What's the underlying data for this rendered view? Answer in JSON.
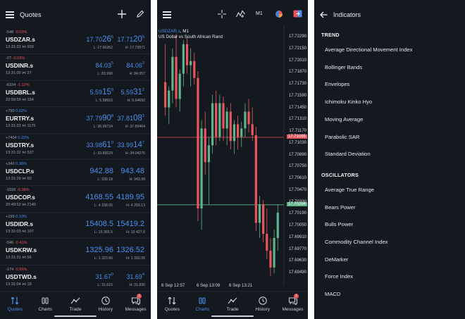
{
  "quotes": {
    "title": "Quotes",
    "items": [
      {
        "delta": "-548",
        "pct": "-0.03%",
        "pct_color": "neg",
        "symbol": "USDZAR.s",
        "time": "13:31:32",
        "vol": "939",
        "bid_a": "17.70",
        "bid_b": "26",
        "bid_s": "6",
        "ask_a": "17.71",
        "ask_b": "20",
        "ask_s": "5",
        "low": "L: 17.66262",
        "high": "H: 17.73571"
      },
      {
        "delta": "-27",
        "pct": "-0.03%",
        "pct_color": "neg",
        "symbol": "USDINR.s",
        "time": "13:31:00",
        "vol": "27",
        "bid_a": "84.03",
        "bid_b": "",
        "bid_s": "5",
        "ask_a": "84.06",
        "ask_b": "",
        "ask_s": "2",
        "low": "L: 83.990",
        "high": "H: 84.057"
      },
      {
        "delta": "-6334",
        "pct": "-1.12%",
        "pct_color": "neg",
        "symbol": "USDBRL.s",
        "time": "22:59:59",
        "vol": "154",
        "bid_a": "5.59",
        "bid_b": "15",
        "bid_s": "8",
        "ask_a": "5.59",
        "ask_b": "31",
        "ask_s": "2",
        "low": "L: 5.58915",
        "high": "H: 5.64692"
      },
      {
        "delta": "+790",
        "pct": "0.02%",
        "pct_color": "pos",
        "symbol": "EURTRY.s",
        "time": "13:31:32",
        "vol": "1175",
        "bid_a": "37.79",
        "bid_b": "90",
        "bid_s": "8",
        "ask_a": "37.81",
        "ask_b": "08",
        "ask_s": "3",
        "low": "L: 36.99724",
        "high": "H: 37.89464"
      },
      {
        "delta": "+7404",
        "pct": "0.22%",
        "pct_color": "pos",
        "symbol": "USDTRY.s",
        "time": "13:31:32",
        "vol": "537",
        "bid_a": "33.98",
        "bid_b": "61",
        "bid_s": "0",
        "ask_a": "33.99",
        "ask_b": "14",
        "ask_s": "7",
        "low": "L: 33.89529",
        "high": "H: 34.04276"
      },
      {
        "delta": "+340",
        "pct": "0.36%",
        "pct_color": "pos",
        "symbol": "USDCLP.s",
        "time": "13:31:29",
        "vol": "60",
        "bid_a": "942.88",
        "bid_b": "",
        "bid_s": "",
        "ask_a": "943.48",
        "ask_b": "",
        "ask_s": "",
        "low": "L: 939.18",
        "high": "H: 943.99"
      },
      {
        "delta": "-1599",
        "pct": "-0.38%",
        "pct_color": "neg",
        "symbol": "USDCOP.s",
        "time": "20:49:52",
        "vol": "2140",
        "bid_a": "4168.55",
        "bid_b": "",
        "bid_s": "",
        "ask_a": "4189.95",
        "ask_b": "",
        "ask_s": "",
        "low": "L: 4 168.05",
        "high": "H: 4 203.13"
      },
      {
        "delta": "+159",
        "pct": "0.10%",
        "pct_color": "pos",
        "symbol": "USDIDR.s",
        "time": "13:31:03",
        "vol": "107",
        "bid_a": "15408.5",
        "bid_b": "",
        "bid_s": "",
        "ask_a": "15419.2",
        "ask_b": "",
        "ask_s": "",
        "low": "L: 15 365.5",
        "high": "H: 15 427.6"
      },
      {
        "delta": "-546",
        "pct": "-0.41%",
        "pct_color": "neg",
        "symbol": "USDKRW.s",
        "time": "13:31:31",
        "vol": "56",
        "bid_a": "1325.96",
        "bid_b": "",
        "bid_s": "",
        "ask_a": "1326.52",
        "ask_b": "",
        "ask_s": "",
        "low": "L: 1 323.66",
        "high": "H: 1 332.05"
      },
      {
        "delta": "-174",
        "pct": "-0.55%",
        "pct_color": "neg",
        "symbol": "USDTWD.s",
        "time": "13:31:04",
        "vol": "18",
        "bid_a": "31.67",
        "bid_b": "",
        "bid_s": "0",
        "ask_a": "31.69",
        "ask_b": "",
        "ask_s": "4",
        "low": "L: 31.615",
        "high": "H: 31.836"
      }
    ]
  },
  "nav": {
    "quotes": "Quotes",
    "charts": "Charts",
    "trade": "Trade",
    "history": "History",
    "messages": "Messages",
    "badge_count": "1"
  },
  "chart": {
    "timeframe": "M1",
    "symbol": "USDZAR.s",
    "symbol_suffix": ", M1",
    "description": "US Dollar vs South African Rand",
    "price_labels": [
      "17.72290",
      "17.72150",
      "17.72010",
      "17.71870",
      "17.71730",
      "17.71590",
      "17.71450",
      "17.71310",
      "17.71170",
      "17.71030",
      "17.70890",
      "17.70750",
      "17.70610",
      "17.70470",
      "17.70330",
      "17.70190",
      "17.70050",
      "17.69910",
      "17.69770",
      "17.69630",
      "17.69490"
    ],
    "bid_line": "17.71095",
    "ask_line": "17.70294",
    "time_labels": [
      "6 Sep 12:57",
      "6 Sep 13:09",
      "6 Sep 13:21"
    ],
    "colors": {
      "bull": "#5fb38a",
      "bear": "#e8575e",
      "ask_line": "#4a90f0"
    }
  },
  "indicators": {
    "title": "Indicators",
    "sections": [
      {
        "name": "TREND",
        "items": [
          "Average Directional Movement Index",
          "Bollinger Bands",
          "Envelopes",
          "Ichimoku Kinko Hyo",
          "Moving Average",
          "Parabolic SAR",
          "Standard Deviation"
        ]
      },
      {
        "name": "OSCILLATORS",
        "items": [
          "Average True Range",
          "Bears Power",
          "Bulls Power",
          "Commodity Channel Index",
          "DeMarker",
          "Force Index",
          "MACD"
        ]
      }
    ]
  },
  "colors": {
    "accent": "#4a90f0",
    "negative": "#e8525a",
    "background": "#14181f"
  }
}
